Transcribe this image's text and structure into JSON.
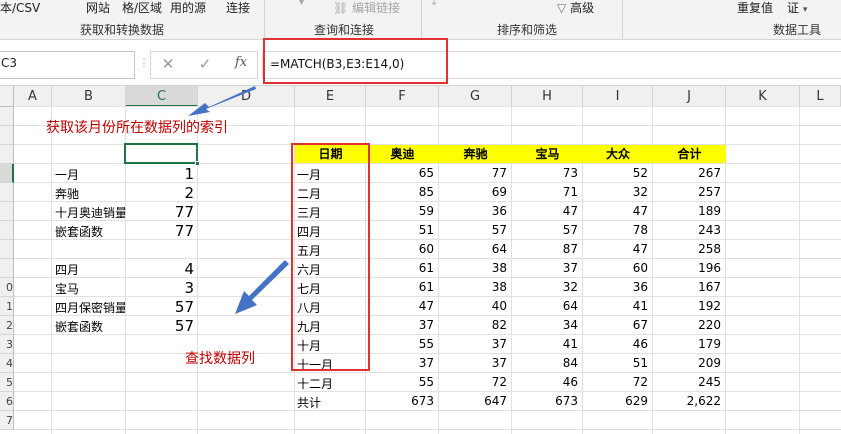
{
  "ribbon": {
    "items": [
      "本/CSV",
      "网站",
      "格/区域",
      "用的源",
      "连接",
      "编辑链接",
      "高级",
      "重复值",
      "证"
    ],
    "groups": [
      "获取和转换数据",
      "查询和连接",
      "排序和筛选",
      "数据工具"
    ]
  },
  "formula_bar": {
    "name_box": "C3",
    "cancel_icon": "✕",
    "enter_icon": "✓",
    "fx_label": "fx",
    "formula": "=MATCH(B3,E3:E14,0)"
  },
  "columns": [
    "A",
    "B",
    "C",
    "D",
    "E",
    "F",
    "G",
    "H",
    "I",
    "J",
    "K",
    "L"
  ],
  "row_numbers": [
    "",
    "",
    "",
    "",
    "",
    "",
    "",
    "",
    "",
    "0",
    "1",
    "2",
    "3",
    "4",
    "5",
    "6",
    "7"
  ],
  "left_table": {
    "rows": [
      {
        "label": "一月",
        "value": "1"
      },
      {
        "label": "奔驰",
        "value": "2"
      },
      {
        "label": "十月奥迪销量",
        "value": "77"
      },
      {
        "label": "嵌套函数",
        "value": "77"
      },
      {
        "label": "",
        "value": ""
      },
      {
        "label": "四月",
        "value": "4"
      },
      {
        "label": "宝马",
        "value": "3"
      },
      {
        "label": "四月保密销量",
        "value": "57"
      },
      {
        "label": "嵌套函数",
        "value": "57"
      }
    ]
  },
  "sales_table": {
    "headers": [
      "日期",
      "奥迪",
      "奔驰",
      "宝马",
      "大众",
      "合计"
    ],
    "rows": [
      [
        "一月",
        "65",
        "77",
        "73",
        "52",
        "267"
      ],
      [
        "二月",
        "85",
        "69",
        "71",
        "32",
        "257"
      ],
      [
        "三月",
        "59",
        "36",
        "47",
        "47",
        "189"
      ],
      [
        "四月",
        "51",
        "57",
        "57",
        "78",
        "243"
      ],
      [
        "五月",
        "60",
        "64",
        "87",
        "47",
        "258"
      ],
      [
        "六月",
        "61",
        "38",
        "37",
        "60",
        "196"
      ],
      [
        "七月",
        "61",
        "38",
        "32",
        "36",
        "167"
      ],
      [
        "八月",
        "47",
        "40",
        "64",
        "41",
        "192"
      ],
      [
        "九月",
        "37",
        "82",
        "34",
        "67",
        "220"
      ],
      [
        "十月",
        "55",
        "37",
        "41",
        "46",
        "179"
      ],
      [
        "十一月",
        "37",
        "37",
        "84",
        "51",
        "209"
      ],
      [
        "十二月",
        "55",
        "72",
        "46",
        "72",
        "245"
      ]
    ],
    "total": [
      "共计",
      "673",
      "647",
      "673",
      "629",
      "2,622"
    ]
  },
  "annotations": {
    "index_note": "获取该月份所在数据列的索引",
    "lookup_note": "查找数据列"
  },
  "colors": {
    "header_fill": "#ffff00",
    "highlight_border": "#e0332f",
    "annotation_text": "#c00000",
    "arrow": "#4472c4",
    "active_cell": "#217346"
  }
}
